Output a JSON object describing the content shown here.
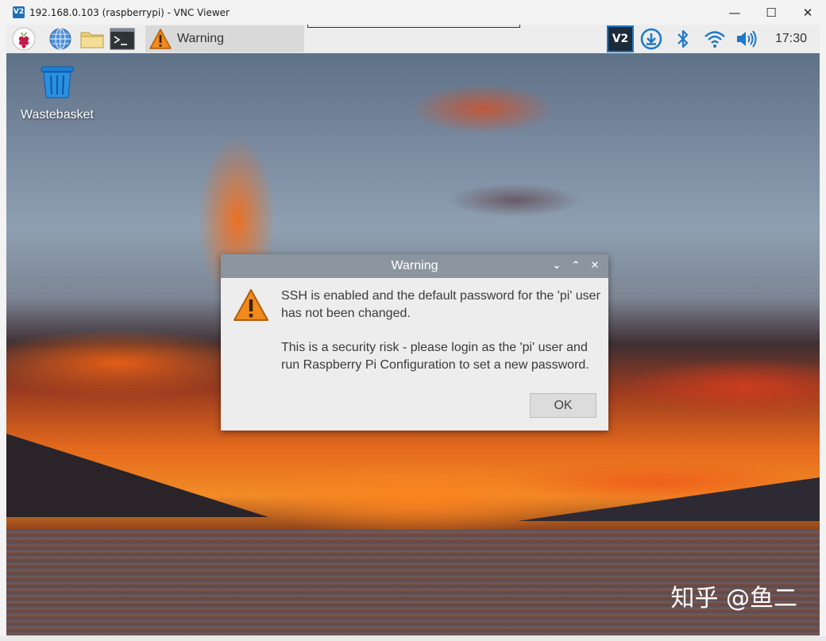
{
  "window": {
    "app_icon_text": "V2",
    "title": "192.168.0.103 (raspberrypi) - VNC Viewer",
    "minimize_glyph": "—",
    "maximize_glyph": "☐",
    "close_glyph": "✕"
  },
  "taskbar": {
    "task_label": "Warning",
    "tray_vnc_text": "V2",
    "clock": "17:30"
  },
  "desktop": {
    "wastebasket_label": "Wastebasket"
  },
  "dialog": {
    "title": "Warning",
    "message_line1": "SSH is enabled and the default password for the 'pi' user has not been changed.",
    "message_line2": "This is a security risk - please login as the 'pi' user and run Raspberry Pi Configuration to set a new password.",
    "ok_label": "OK",
    "ctrl_min": "⌄",
    "ctrl_max": "⌃",
    "ctrl_close": "✕"
  },
  "watermark": "知乎 @鱼二",
  "colors": {
    "taskbar_bg": "#ededed",
    "dialog_title_bg": "#8b95a0",
    "warning_orange": "#f08a1c",
    "tray_blue": "#1c78c8"
  },
  "icons": [
    "raspberry-icon",
    "globe-icon",
    "folder-icon",
    "terminal-icon",
    "warning-icon",
    "vnc-icon",
    "download-icon",
    "bluetooth-icon",
    "wifi-icon",
    "volume-icon",
    "wastebasket-icon"
  ]
}
